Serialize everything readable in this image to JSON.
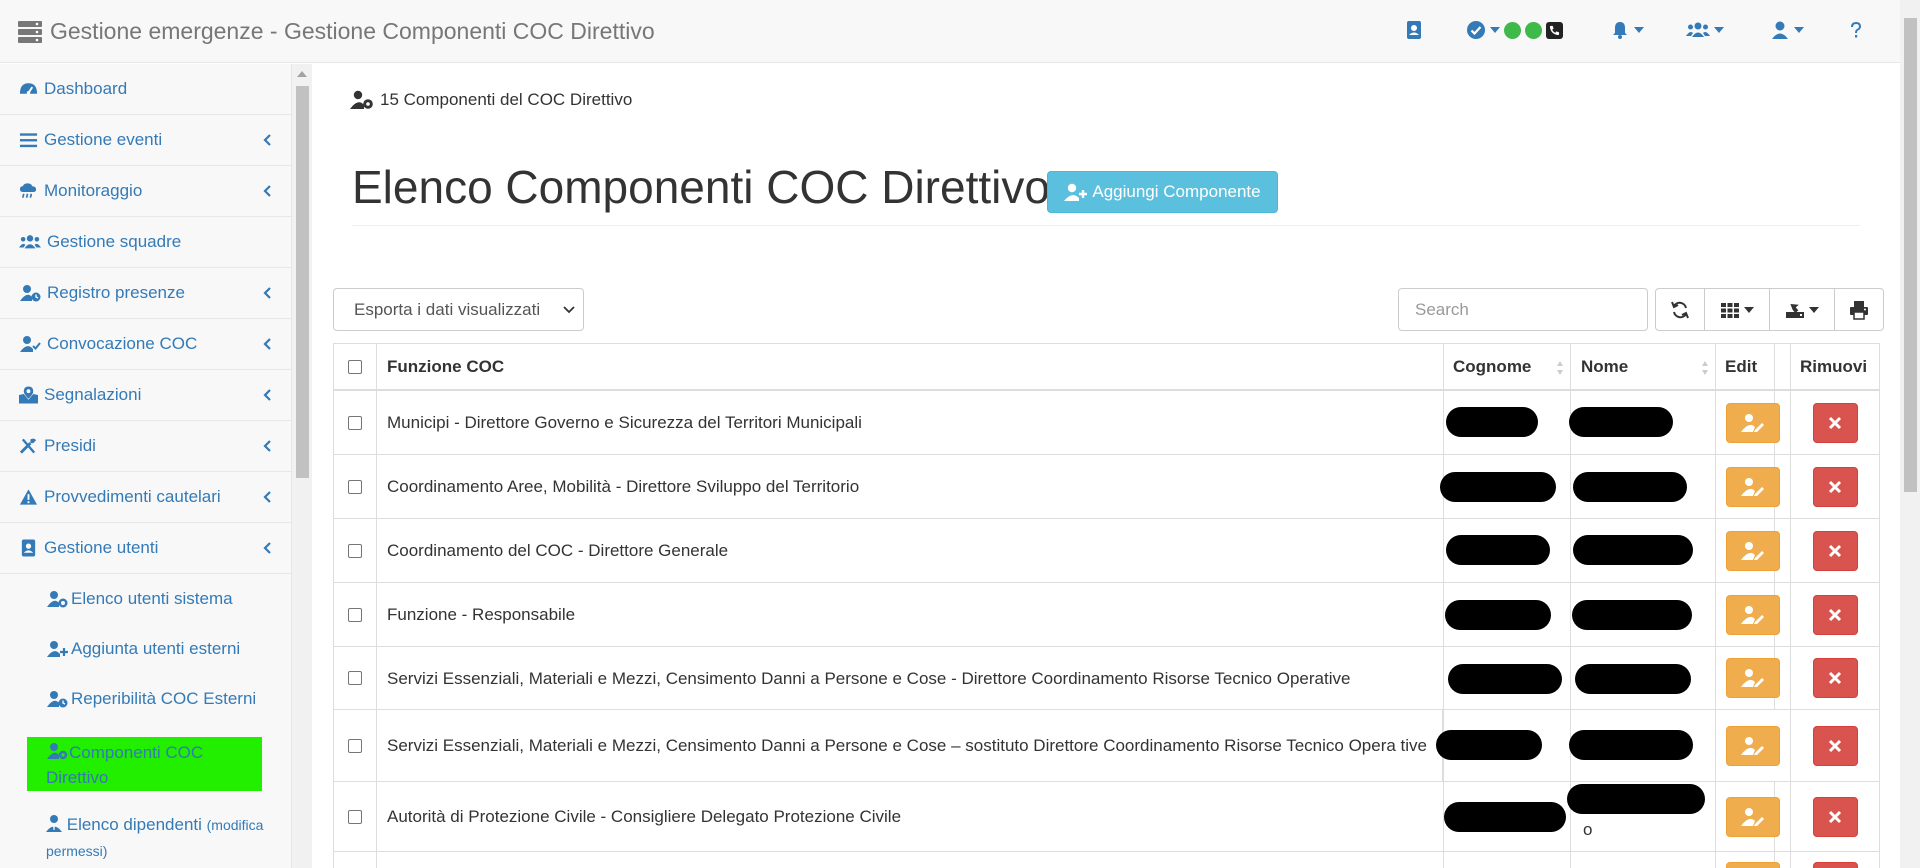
{
  "header": {
    "title": "Gestione emergenze - Gestione Componenti COC Direttivo"
  },
  "sidebar": {
    "items": [
      {
        "label": "Dashboard",
        "icon": "tachometer-icon"
      },
      {
        "label": "Gestione eventi",
        "icon": "list-icon"
      },
      {
        "label": "Monitoraggio",
        "icon": "cloud-rain-icon"
      },
      {
        "label": "Gestione squadre",
        "icon": "users-icon"
      },
      {
        "label": "Registro presenze",
        "icon": "user-clock-icon"
      },
      {
        "label": "Convocazione COC",
        "icon": "user-check-icon"
      },
      {
        "label": "Segnalazioni",
        "icon": "map-marked-icon"
      },
      {
        "label": "Presidi",
        "icon": "tools-icon"
      },
      {
        "label": "Provvedimenti cautelari",
        "icon": "warning-icon"
      },
      {
        "label": "Gestione utenti",
        "icon": "address-book-icon"
      }
    ],
    "subitems": [
      {
        "label": "Elenco utenti sistema",
        "icon": "user-clock-icon"
      },
      {
        "label": "Aggiunta utenti esterni",
        "icon": "user-plus-icon"
      },
      {
        "label": "Reperibilità COC Esterni",
        "icon": "user-clock-icon"
      }
    ],
    "active_line1": "Componenti COC",
    "active_line2": "Direttivo",
    "last_label": "Elenco dipendenti",
    "last_note": "(modifica permessi)"
  },
  "main": {
    "breadcrumb": "15 Componenti del COC Direttivo",
    "title": "Elenco Componenti COC Direttivo",
    "add_button": "Aggiungi Componente",
    "export_select": "Esporta i dati visualizzati",
    "search_placeholder": "Search"
  },
  "table": {
    "headers": {
      "funzione": "Funzione COC",
      "cognome": "Cognome",
      "nome": "Nome",
      "edit": "Edit",
      "rimuovi": "Rimuovi"
    },
    "rows": [
      {
        "bold": "Municipi",
        "rest": " - Direttore Governo e Sicurezza del Territori Municipali"
      },
      {
        "bold": "Coordinamento Aree, Mobilità",
        "rest": " - Direttore Sviluppo del Territorio"
      },
      {
        "bold": "Coordinamento del COC",
        "rest": " - Direttore Generale"
      },
      {
        "bold": "Funzione",
        "rest": " - Responsabile"
      },
      {
        "bold": "Servizi Essenziali, Materiali e Mezzi, Censimento Danni a Persone e Cose",
        "rest": " - Direttore Coordinamento Risorse Tecnico Operative"
      },
      {
        "bold": "Servizi Essenziali, Materiali e Mezzi, Censimento Danni a Persone e Cose",
        "rest": " – sostituto Direttore Coordinamento Risorse Tecnico Opera tive"
      },
      {
        "bold": "Autorità di Protezione Civile",
        "rest": " - Consigliere Delegato Protezione Civile",
        "nome_tail": "o"
      }
    ]
  },
  "colors": {
    "link": "#337ab7",
    "active_highlight": "#22ee00",
    "status_dot": "#3fb94a",
    "info_button": "#5bc0de",
    "edit_button": "#f0ad4e",
    "remove_button": "#d9534f"
  }
}
